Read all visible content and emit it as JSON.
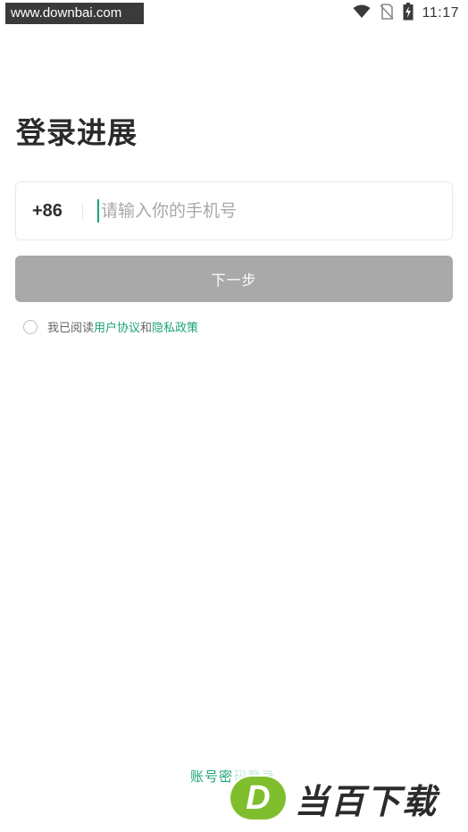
{
  "watermark": {
    "top_text": "www.downbai.com",
    "logo_letter": "D",
    "logo_brand": "当百下载"
  },
  "status_bar": {
    "time": "11:17",
    "icons": [
      "wifi-icon",
      "no-sim-icon",
      "battery-charging-icon"
    ]
  },
  "page": {
    "title": "登录进展"
  },
  "phone": {
    "country_code": "+86",
    "placeholder": "请输入你的手机号",
    "value": ""
  },
  "next_button": {
    "label": "下一步",
    "enabled": false,
    "color": "#a9a9a9"
  },
  "agreement": {
    "prefix": "我已阅读",
    "user_agreement": "用户协议",
    "and": "和",
    "privacy_policy": "隐私政策",
    "checked": false,
    "link_color": "#1aa37a"
  },
  "footer": {
    "account_login_visible": "账号密",
    "account_login_obscured": "码登录"
  }
}
